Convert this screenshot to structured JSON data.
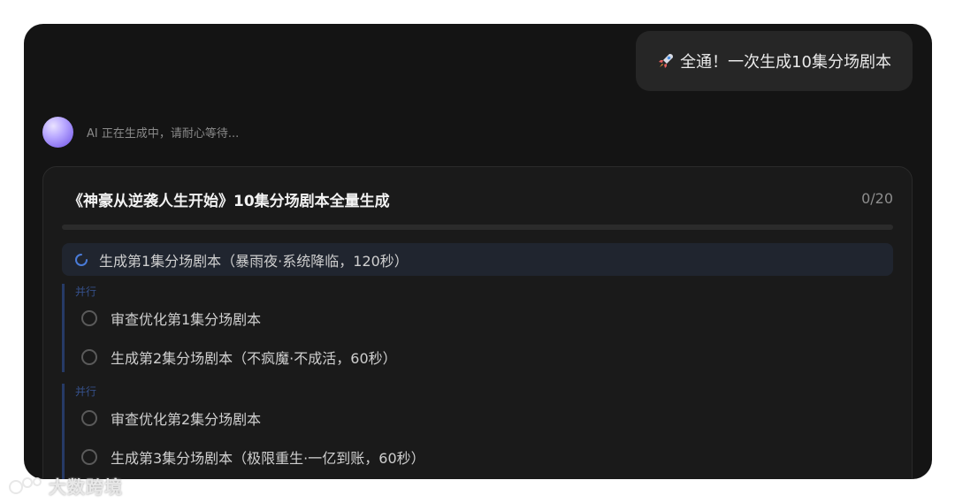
{
  "user_message": {
    "icon": "rocket-icon",
    "text": "全通！一次生成10集分场剧本"
  },
  "ai_status": {
    "text": "AI 正在生成中，请耐心等待..."
  },
  "task_card": {
    "title": "《神豪从逆袭人生开始》10集分场剧本全量生成",
    "count": "0/20",
    "progress": 0,
    "active_task": {
      "status": "in-progress",
      "label": "生成第1集分场剧本（暴雨夜·系统降临，120秒）"
    },
    "groups": [
      {
        "label": "并行",
        "tasks": [
          {
            "status": "pending",
            "label": "审查优化第1集分场剧本"
          },
          {
            "status": "pending",
            "label": "生成第2集分场剧本（不疯魔·不成活，60秒）"
          }
        ]
      },
      {
        "label": "并行",
        "tasks": [
          {
            "status": "pending",
            "label": "审查优化第2集分场剧本"
          },
          {
            "status": "pending",
            "label": "生成第3集分场剧本（极限重生·一亿到账，60秒）"
          }
        ]
      }
    ]
  },
  "colors": {
    "background": "#141414",
    "card": "#1a1a1a",
    "accent": "#4a7bd8",
    "group_line": "#263a66"
  },
  "watermark": {
    "text": "大数跨境"
  }
}
